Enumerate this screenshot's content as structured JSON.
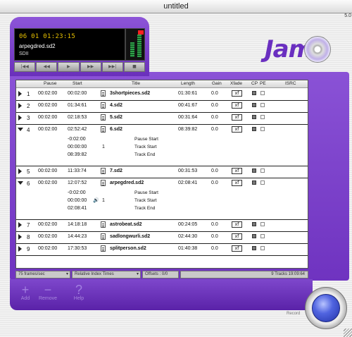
{
  "window": {
    "title": "untitled",
    "corner_text": "5.0"
  },
  "player": {
    "counter": "06 01 01:23:15",
    "filename": "arpegdred.sd2",
    "format": "SDII",
    "meter_levels": [
      0.55,
      0.85
    ],
    "transport": [
      "|◀◀",
      "◀◀",
      "▶",
      "▶▶",
      "▶▶|",
      "■"
    ]
  },
  "brand": {
    "logo": "Jam"
  },
  "columns": [
    "Pause",
    "Start",
    "Title",
    "Length",
    "Gain",
    "Xfade",
    "CP",
    "PE",
    "ISRC"
  ],
  "tracks": [
    {
      "n": "1",
      "expanded": false,
      "pause": "00:02:00",
      "start": "00:02:00",
      "title": "3shortpieces.sd2",
      "length": "01:30:61",
      "gain": "0.0",
      "xfade": "xf"
    },
    {
      "n": "2",
      "expanded": false,
      "pause": "00:02:00",
      "start": "01:34:61",
      "title": "4.sd2",
      "length": "00:41:67",
      "gain": "0.0",
      "xfade": "xf"
    },
    {
      "n": "3",
      "expanded": false,
      "pause": "00:02:00",
      "start": "02:18:53",
      "title": "5.sd2",
      "length": "00:31:64",
      "gain": "0.0",
      "xfade": "xf"
    },
    {
      "n": "4",
      "expanded": true,
      "pause": "00:02:00",
      "start": "02:52:42",
      "title": "6.sd2",
      "length": "08:39:82",
      "gain": "0.0",
      "xfade": "xf",
      "subs": [
        {
          "time": "-0:02:00",
          "idx": "",
          "label": "Pause Start",
          "speaker": false
        },
        {
          "time": "00:00:00",
          "idx": "1",
          "label": "Track Start",
          "speaker": false
        },
        {
          "time": "08:39:82",
          "idx": "",
          "label": "Track End",
          "speaker": false
        }
      ]
    },
    {
      "n": "5",
      "expanded": false,
      "pause": "00:02:00",
      "start": "11:33:74",
      "title": "7.sd2",
      "length": "00:31:53",
      "gain": "0.0",
      "xfade": "xf"
    },
    {
      "n": "6",
      "expanded": true,
      "pause": "00:02:00",
      "start": "12:07:52",
      "title": "arpegdred.sd2",
      "length": "02:08:41",
      "gain": "0.0",
      "xfade": "xf",
      "subs": [
        {
          "time": "-0:02:00",
          "idx": "",
          "label": "Pause Start",
          "speaker": false
        },
        {
          "time": "00:00:00",
          "idx": "1",
          "label": "Track Start",
          "speaker": true
        },
        {
          "time": "02:08:41",
          "idx": "",
          "label": "Track End",
          "speaker": false
        }
      ]
    },
    {
      "n": "7",
      "expanded": false,
      "pause": "00:02:00",
      "start": "14:18:18",
      "title": "astrobeat.sd2",
      "length": "00:24:05",
      "gain": "0.0",
      "xfade": "xf"
    },
    {
      "n": "8",
      "expanded": false,
      "pause": "00:02:00",
      "start": "14:44:23",
      "title": "sadlongwurli.sd2",
      "length": "02:44:30",
      "gain": "0.0",
      "xfade": "xf"
    },
    {
      "n": "9",
      "expanded": false,
      "pause": "00:02:00",
      "start": "17:30:53",
      "title": "splitperson.sd2",
      "length": "01:40:38",
      "gain": "0.0",
      "xfade": "xf"
    }
  ],
  "status": {
    "frames": "75 frames/sec",
    "index_mode": "Relative Index Times",
    "offsets": "Offsets : 0/0",
    "summary": "9 Tracks 19:09:64"
  },
  "actions": {
    "add": "Add",
    "remove": "Remove",
    "help": "Help",
    "record": "Record"
  }
}
